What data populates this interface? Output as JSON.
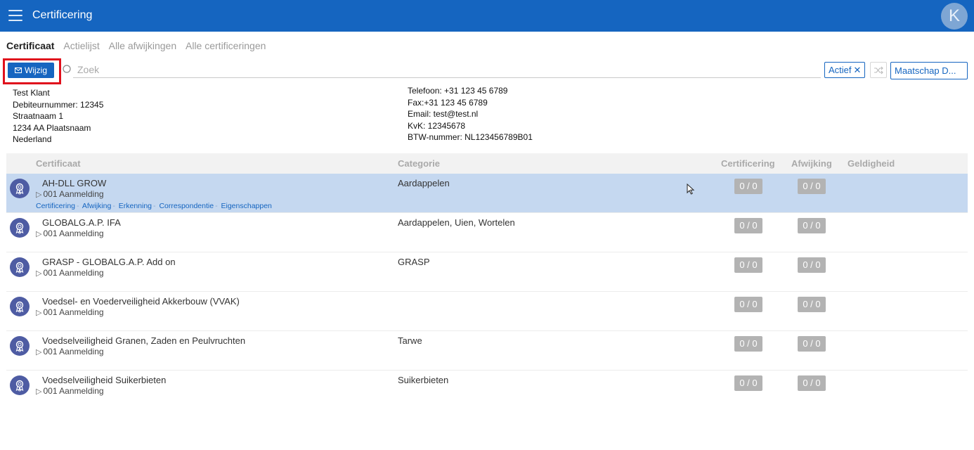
{
  "header": {
    "title": "Certificering",
    "avatar_letter": "K",
    "menu_icon": "hamburger-icon",
    "color": "#1565c0"
  },
  "tabs": [
    {
      "label": "Certificaat",
      "active": true
    },
    {
      "label": "Actielijst",
      "active": false
    },
    {
      "label": "Alle afwijkingen",
      "active": false
    },
    {
      "label": "Alle certificeringen",
      "active": false
    }
  ],
  "toolbar": {
    "edit_label": "Wijzig",
    "search_placeholder": "Zoek",
    "filter_label": "Actief",
    "maatschap_label": "Maatschap D..."
  },
  "customer": {
    "address": [
      "Test Klant",
      "Debiteurnummer: 12345",
      "Straatnaam 1",
      "1234 AA Plaatsnaam",
      "Nederland"
    ],
    "contact": [
      "Telefoon: +31 123 45 6789",
      "Fax:+31 123 45 6789",
      "Email: test@test.nl",
      "KvK: 12345678",
      "BTW-nummer: NL123456789B01"
    ]
  },
  "table": {
    "columns": [
      "Certificaat",
      "Categorie",
      "Certificering",
      "Afwijking",
      "Geldigheid"
    ],
    "rows": [
      {
        "name": "AH-DLL GROW",
        "sub": "001 Aanmelding",
        "category": "Aardappelen",
        "certificering": "0 / 0",
        "afwijking": "0 / 0",
        "selected": true,
        "links": [
          "Certificering",
          "Afwijking",
          "Erkenning",
          "Correspondentie",
          "Eigenschappen"
        ]
      },
      {
        "name": "GLOBALG.A.P. IFA",
        "sub": "001 Aanmelding",
        "category": "Aardappelen, Uien, Wortelen",
        "certificering": "0 / 0",
        "afwijking": "0 / 0"
      },
      {
        "name": "GRASP - GLOBALG.A.P. Add on",
        "sub": "001 Aanmelding",
        "category": "GRASP",
        "certificering": "0 / 0",
        "afwijking": "0 / 0"
      },
      {
        "name": "Voedsel- en Voederveiligheid Akkerbouw (VVAK)",
        "sub": "001 Aanmelding",
        "category": "",
        "certificering": "0 / 0",
        "afwijking": "0 / 0"
      },
      {
        "name": "Voedselveiligheid Granen, Zaden en Peulvruchten",
        "sub": "001 Aanmelding",
        "category": "Tarwe",
        "certificering": "0 / 0",
        "afwijking": "0 / 0"
      },
      {
        "name": "Voedselveiligheid Suikerbieten",
        "sub": "001 Aanmelding",
        "category": "Suikerbieten",
        "certificering": "0 / 0",
        "afwijking": "0 / 0"
      }
    ]
  }
}
